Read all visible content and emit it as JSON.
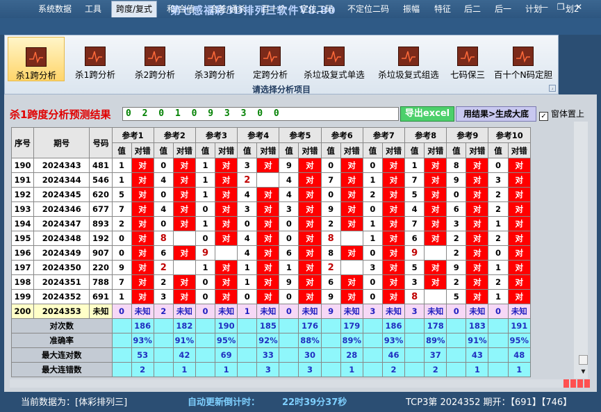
{
  "window": {
    "title": "第七感福彩3D排列三软件V8.80",
    "min_icon": "minimize-icon",
    "restore_icon": "restore-icon",
    "close_icon": "close-icon"
  },
  "menu": [
    "系统数据",
    "工具",
    "跨度/复式",
    "和/合值",
    "合差/通杀",
    "百十个",
    "定位二码",
    "不定位二码",
    "振幅",
    "特征",
    "后二",
    "后一",
    "计划",
    "·划2"
  ],
  "menu_active": "跨度/复式",
  "ribbon": {
    "buttons": [
      "杀1跨分析",
      "杀1跨分析",
      "杀2跨分析",
      "杀3跨分析",
      "定跨分析",
      "杀垃圾复式单选",
      "杀垃圾复式组选",
      "七码保三",
      "百十个N码定胆"
    ],
    "caption": "请选择分析项目"
  },
  "prediction": {
    "label": "杀1跨度分析预测结果",
    "value": "0 2 0 1 0 9 3 3 0 0",
    "excel_button": "导出excel",
    "gen_button": "用结果>生成大底",
    "ontop_label": "窗体置上",
    "ontop_checked": true
  },
  "grid": {
    "col_seq": "序号",
    "col_issue": "期号",
    "col_code": "号码",
    "ref_groups": [
      "参考1",
      "参考2",
      "参考3",
      "参考4",
      "参考5",
      "参考6",
      "参考7",
      "参考8",
      "参考9",
      "参考10"
    ],
    "sub_value": "值",
    "sub_check": "对错",
    "mark_right": "对",
    "rows": [
      {
        "seq": "190",
        "issue": "2024343",
        "code": "481",
        "vals": [
          "1",
          "0",
          "1",
          "3",
          "9",
          "0",
          "0",
          "1",
          "8",
          "0"
        ],
        "wrong": [
          false,
          false,
          false,
          false,
          false,
          false,
          false,
          false,
          false,
          false
        ]
      },
      {
        "seq": "191",
        "issue": "2024344",
        "code": "546",
        "vals": [
          "1",
          "4",
          "1",
          "2",
          "4",
          "7",
          "1",
          "7",
          "9",
          "3"
        ],
        "wrong": [
          false,
          false,
          false,
          true,
          false,
          false,
          false,
          false,
          false,
          false
        ]
      },
      {
        "seq": "192",
        "issue": "2024345",
        "code": "620",
        "vals": [
          "5",
          "0",
          "1",
          "4",
          "4",
          "0",
          "2",
          "5",
          "0",
          "2"
        ],
        "wrong": [
          false,
          false,
          false,
          false,
          false,
          false,
          false,
          false,
          false,
          false
        ]
      },
      {
        "seq": "193",
        "issue": "2024346",
        "code": "677",
        "vals": [
          "7",
          "4",
          "0",
          "3",
          "3",
          "9",
          "0",
          "4",
          "6",
          "2"
        ],
        "wrong": [
          false,
          false,
          false,
          false,
          false,
          false,
          false,
          false,
          false,
          false
        ]
      },
      {
        "seq": "194",
        "issue": "2024347",
        "code": "893",
        "vals": [
          "2",
          "0",
          "1",
          "0",
          "0",
          "2",
          "1",
          "7",
          "3",
          "1"
        ],
        "wrong": [
          false,
          false,
          false,
          false,
          false,
          false,
          false,
          false,
          false,
          false
        ]
      },
      {
        "seq": "195",
        "issue": "2024348",
        "code": "192",
        "vals": [
          "0",
          "8",
          "0",
          "4",
          "0",
          "8",
          "1",
          "6",
          "2",
          "2"
        ],
        "wrong": [
          false,
          true,
          false,
          false,
          false,
          true,
          false,
          false,
          false,
          false
        ]
      },
      {
        "seq": "196",
        "issue": "2024349",
        "code": "907",
        "vals": [
          "0",
          "6",
          "9",
          "4",
          "6",
          "8",
          "0",
          "9",
          "2",
          "0"
        ],
        "wrong": [
          false,
          false,
          true,
          false,
          false,
          false,
          false,
          true,
          false,
          false
        ]
      },
      {
        "seq": "197",
        "issue": "2024350",
        "code": "220",
        "vals": [
          "9",
          "2",
          "1",
          "1",
          "1",
          "2",
          "3",
          "5",
          "9",
          "1"
        ],
        "wrong": [
          false,
          true,
          false,
          false,
          false,
          true,
          false,
          false,
          false,
          false
        ]
      },
      {
        "seq": "198",
        "issue": "2024351",
        "code": "788",
        "vals": [
          "7",
          "2",
          "0",
          "1",
          "9",
          "6",
          "0",
          "3",
          "2",
          "2"
        ],
        "wrong": [
          false,
          false,
          false,
          false,
          false,
          false,
          false,
          false,
          false,
          false
        ]
      },
      {
        "seq": "199",
        "issue": "2024352",
        "code": "691",
        "vals": [
          "1",
          "3",
          "0",
          "0",
          "0",
          "9",
          "0",
          "8",
          "5",
          "1"
        ],
        "wrong": [
          false,
          false,
          false,
          false,
          false,
          false,
          false,
          true,
          false,
          false
        ]
      }
    ],
    "pred_row": {
      "seq": "200",
      "issue": "2024353",
      "code": "未知",
      "vals": [
        "0",
        "2",
        "0",
        "1",
        "0",
        "9",
        "3",
        "3",
        "0",
        "0"
      ],
      "mark": "未知"
    },
    "stats": [
      {
        "label": "对次数",
        "vals": [
          "186",
          "182",
          "190",
          "185",
          "176",
          "179",
          "186",
          "178",
          "183",
          "191"
        ]
      },
      {
        "label": "准确率",
        "vals": [
          "93%",
          "91%",
          "95%",
          "92%",
          "88%",
          "89%",
          "93%",
          "89%",
          "91%",
          "95%"
        ]
      },
      {
        "label": "最大连对数",
        "vals": [
          "53",
          "42",
          "69",
          "33",
          "30",
          "28",
          "46",
          "37",
          "43",
          "48"
        ]
      },
      {
        "label": "最大连错数",
        "vals": [
          "2",
          "1",
          "1",
          "3",
          "3",
          "1",
          "2",
          "2",
          "1",
          "1"
        ]
      }
    ]
  },
  "status": {
    "current_data": "当前数据为：[体彩排列三]",
    "countdown_label": "自动更新倒计时：",
    "countdown_value": "22时39分37秒",
    "draw_info": "TCP3第 2024352 期开：【691】【746】"
  },
  "colors": {
    "hit": "#ff0000",
    "stat_bg": "#8ff7fb",
    "pred_bg": "#f6d8f6",
    "title": "#b9d2ff"
  }
}
